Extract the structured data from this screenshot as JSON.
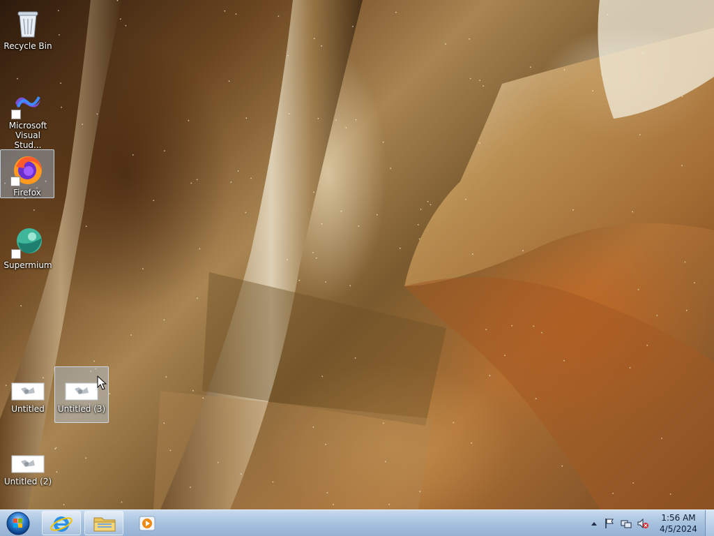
{
  "desktop": {
    "icons": [
      {
        "label": "Recycle Bin",
        "icon": "recycle-bin-icon"
      },
      {
        "label": "Microsoft Visual Stud...",
        "icon": "visual-studio-icon"
      },
      {
        "label": "Firefox",
        "icon": "firefox-icon",
        "selected": true
      },
      {
        "label": "Supermium",
        "icon": "supermium-icon"
      },
      {
        "label": "Untitled",
        "icon": "image-file-icon"
      },
      {
        "label": "Untitled (3)",
        "icon": "image-file-icon",
        "selected": true
      },
      {
        "label": "Untitled (2)",
        "icon": "image-file-icon"
      }
    ]
  },
  "taskbar": {
    "start_button": "start-orb-icon",
    "pinned": [
      {
        "name": "Internet Explorer",
        "icon": "internet-explorer-icon"
      },
      {
        "name": "Windows Explorer",
        "icon": "folder-icon"
      },
      {
        "name": "Windows Media Player",
        "icon": "media-player-icon"
      }
    ],
    "tray": {
      "icons": [
        "show-hidden-icons-chevron",
        "action-center-flag-icon",
        "network-icon",
        "volume-muted-icon"
      ],
      "time": "1:56 AM",
      "date": "4/5/2024"
    }
  },
  "colors": {
    "taskbar_top": "#c9dbee",
    "taskbar_bottom": "#93b1d4",
    "selection": "#b4d2f5"
  }
}
